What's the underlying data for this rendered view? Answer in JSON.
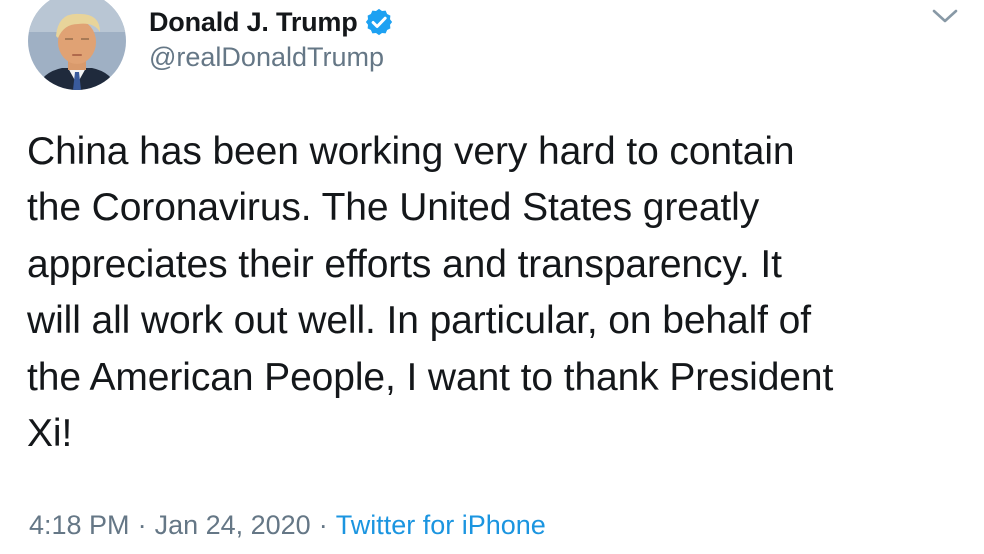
{
  "user": {
    "display_name": "Donald J. Trump",
    "handle": "@realDonaldTrump",
    "verified": true,
    "avatar": "profile-photo"
  },
  "tweet": {
    "text": "China has been working very hard to contain\nthe Coronavirus. The United States greatly\nappreciates their efforts and transparency. It\nwill all work out well. In particular, on behalf of\nthe American People, I want to thank President\nXi!",
    "time": "4:18 PM",
    "date": "Jan 24, 2020",
    "separator": "·",
    "source": "Twitter for iPhone"
  },
  "icons": {
    "verified": "verified-badge-icon",
    "menu": "chevron-down-icon"
  },
  "colors": {
    "text": "#14171a",
    "secondary": "#657786",
    "link": "#1b95e0",
    "verified": "#1da1f2"
  }
}
